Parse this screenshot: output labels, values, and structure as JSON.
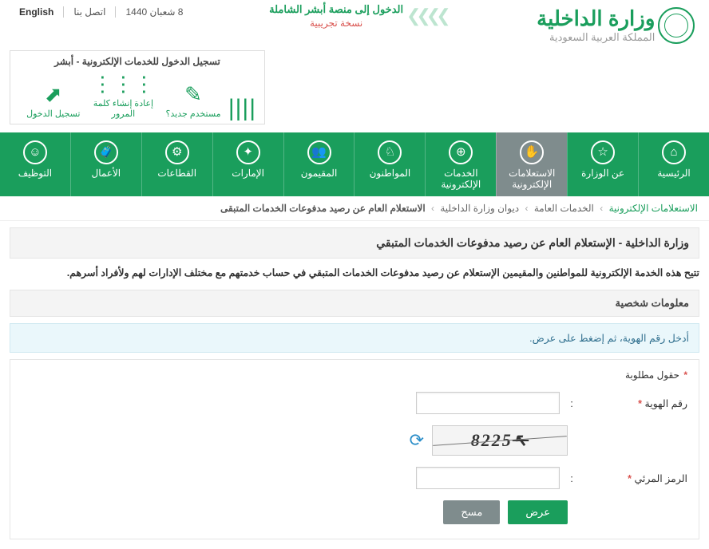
{
  "top": {
    "date": "8 شعبان 1440",
    "contact": "اتصل بنا",
    "lang": "English"
  },
  "absher_banner": {
    "line1": "الدخول إلى منصة أبشر الشاملة",
    "line2": "نسخة تجريبية"
  },
  "logo": {
    "title": "وزارة الداخلية",
    "subtitle": "المملكة العربية السعودية"
  },
  "login_widget": {
    "title": "تسجيل الدخول للخدمات الإلكترونية - أبشر",
    "items": [
      "مستخدم جديد؟",
      "إعادة إنشاء كلمة المرور",
      "تسجيل الدخول"
    ]
  },
  "nav": [
    {
      "label": "الرئيسية",
      "icon": "⌂"
    },
    {
      "label": "عن الوزارة",
      "icon": "☆"
    },
    {
      "label": "الاستعلامات الإلكترونية",
      "icon": "✋",
      "active": true
    },
    {
      "label": "الخدمات الإلكترونية",
      "icon": "⊕"
    },
    {
      "label": "المواطنون",
      "icon": "♘"
    },
    {
      "label": "المقيمون",
      "icon": "👥"
    },
    {
      "label": "الإمارات",
      "icon": "✦"
    },
    {
      "label": "القطاعات",
      "icon": "⚙"
    },
    {
      "label": "الأعمال",
      "icon": "🧳"
    },
    {
      "label": "التوظيف",
      "icon": "☺"
    }
  ],
  "breadcrumb": {
    "root": "الاستعلامات الإلكترونية",
    "l1": "الخدمات العامة",
    "l2": "ديوان وزارة الداخلية",
    "cur": "الاستعلام العام عن رصيد مدفوعات الخدمات المتبقى"
  },
  "page_title": "وزارة الداخلية - الإستعلام العام عن رصيد مدفوعات الخدمات المتبقي",
  "description": "تتيح هذه الخدمة الإلكترونية للمواطنين والمقيمين الإستعلام عن رصيد مدفوعات الخدمات المتبقي في حساب خدمتهم مع مختلف الإدارات لهم ولأفراد أسرهم.",
  "section_head": "معلومات شخصية",
  "info_msg": "أدخل رقم الهوية، ثم إضغط على عرض.",
  "form": {
    "required_note": "حقول مطلوبة",
    "id_label": "رقم الهوية",
    "id_value": "",
    "captcha_label": "الرمز المرئي",
    "captcha_value": "",
    "captcha_text": "8225",
    "submit": "عرض",
    "reset": "مسح"
  }
}
